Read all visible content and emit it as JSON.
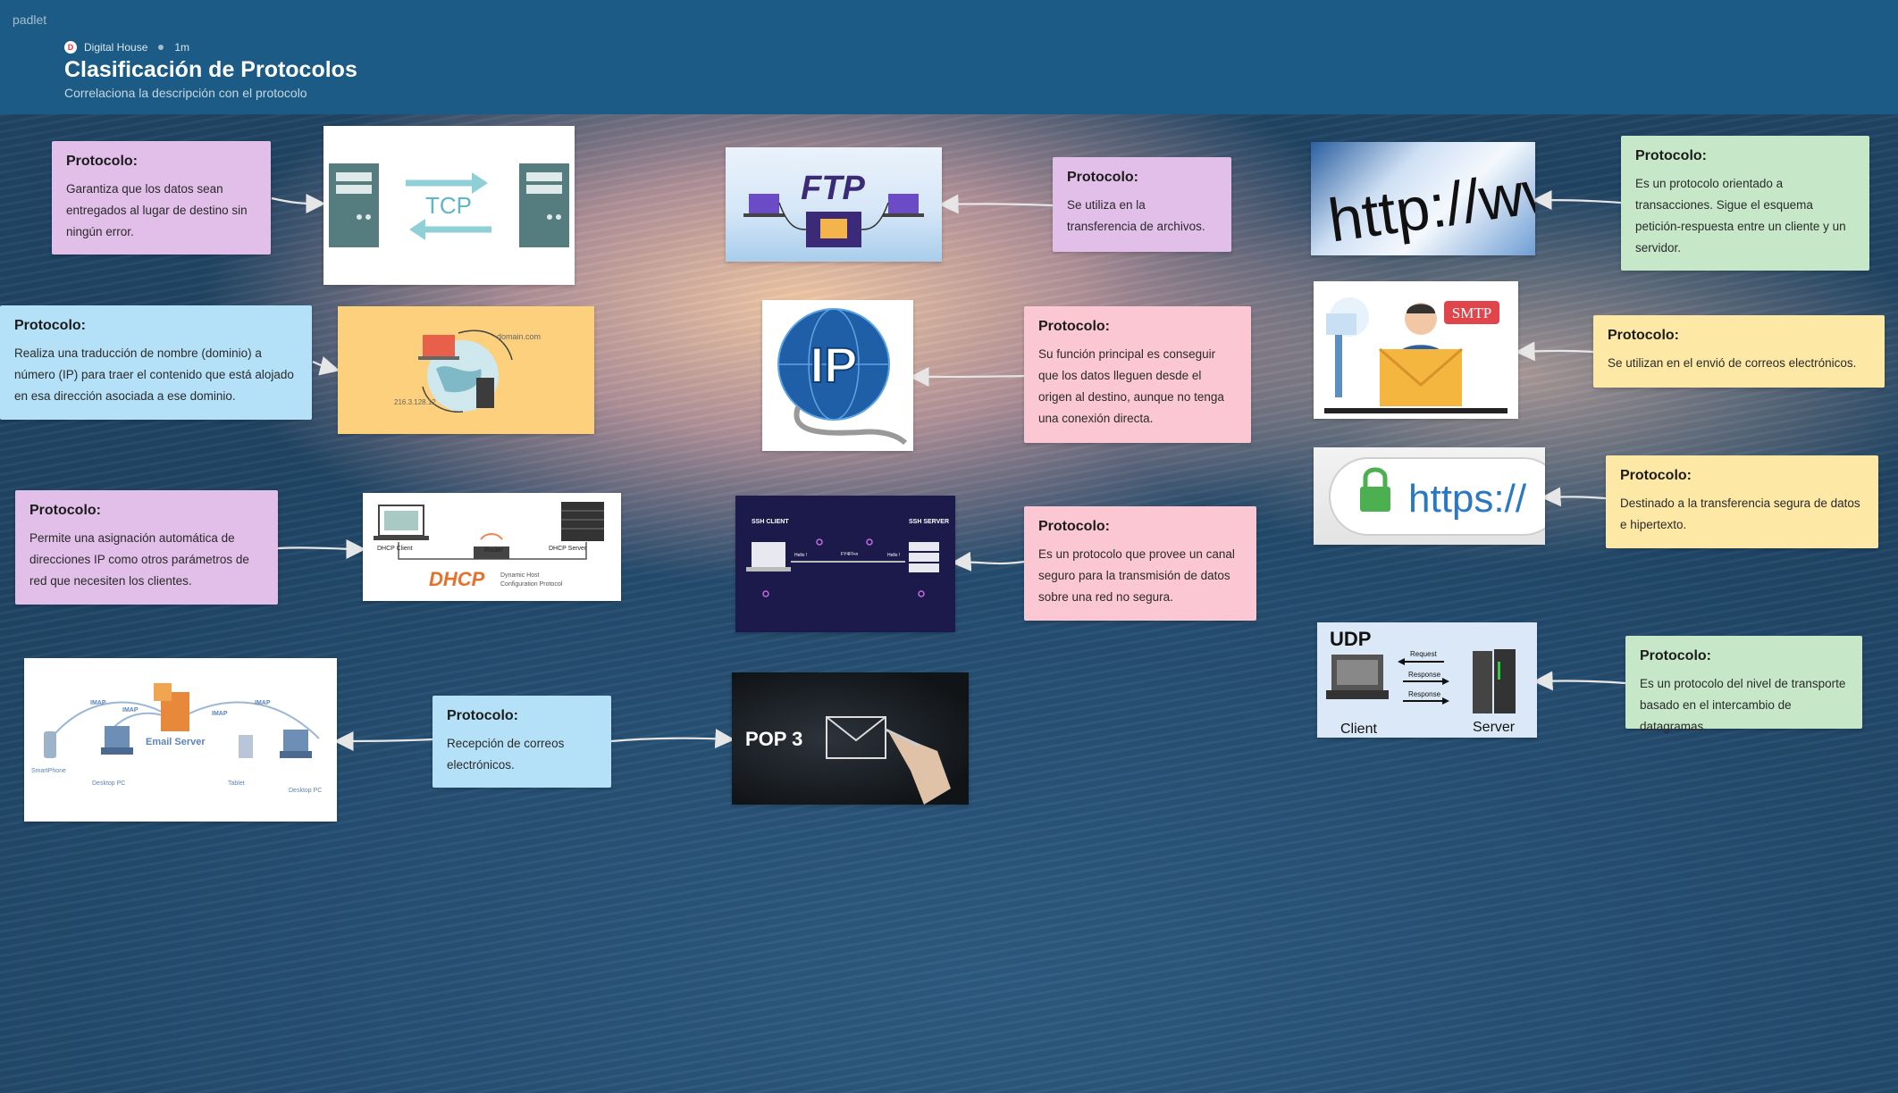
{
  "header": {
    "brand": "padlet",
    "author": "Digital House",
    "age": "1m",
    "title": "Clasificación de Protocolos",
    "subtitle": "Correlaciona la descripción con el protocolo"
  },
  "cards": [
    {
      "id": "tcp",
      "title": "Protocolo:",
      "text": "Garantiza que los datos sean entregados al lugar de destino sin ningún error."
    },
    {
      "id": "dns",
      "title": "Protocolo:",
      "text": "Realiza una traducción de nombre (dominio) a número (IP) para traer el contenido que está alojado en esa dirección asociada a ese dominio."
    },
    {
      "id": "dhcp",
      "title": "Protocolo:",
      "text": "Permite una asignación automática de direcciones IP como otros parámetros de red que necesiten los clientes."
    },
    {
      "id": "imap",
      "title": "Protocolo:",
      "text": "Recepción de correos electrónicos."
    },
    {
      "id": "ftp",
      "title": "Protocolo:",
      "text": "Se utiliza en la transferencia de archivos."
    },
    {
      "id": "ip",
      "title": "Protocolo:",
      "text": "Su función principal es conseguir que los datos lleguen desde el origen al destino, aunque no tenga una conexión directa."
    },
    {
      "id": "ssh",
      "title": "Protocolo:",
      "text": "Es un protocolo que provee un canal seguro para la transmisión de datos sobre una red no segura."
    },
    {
      "id": "http",
      "title": "Protocolo:",
      "text": "Es un protocolo orientado a transacciones. Sigue el esquema petición-respuesta entre un cliente y un servidor."
    },
    {
      "id": "smtp",
      "title": "Protocolo:",
      "text": "Se utilizan en el envió de correos electrónicos."
    },
    {
      "id": "https",
      "title": "Protocolo:",
      "text": "Destinado a la transferencia segura de datos e hipertexto."
    },
    {
      "id": "udp",
      "title": "Protocolo:",
      "text": "Es un protocolo del nivel de transporte basado en el intercambio de datagramas."
    }
  ],
  "images": {
    "tcp": {
      "label": "TCP"
    },
    "ftp": {
      "label": "FTP"
    },
    "http": {
      "label": "http://www"
    },
    "dns": {
      "domain": "domain.com",
      "ip": "216.3.128.12"
    },
    "ip": {
      "label": "IP"
    },
    "smtp": {
      "label": "SMTP"
    },
    "https": {
      "label": "https://"
    },
    "dhcp": {
      "label": "DHCP",
      "client": "DHCP Client",
      "router": "Router",
      "server": "DHCP Server",
      "desc1": "Dynamic Host",
      "desc2": "Configuration Protocol"
    },
    "ssh": {
      "client": "SSH CLIENT",
      "server": "SSH SERVER",
      "hello1": "Hello !",
      "hello2": "Hello !",
      "mid": "FY4Ff+n"
    },
    "udp": {
      "label": "UDP",
      "request": "Request",
      "response1": "Response",
      "response2": "Response",
      "client": "Client",
      "server": "Server"
    },
    "imap": {
      "server": "Email Server",
      "smartphone": "SmartPhone",
      "desktop1": "Desktop PC",
      "tablet": "Tablet",
      "desktop2": "Desktop PC",
      "imap": "IMAP"
    },
    "pop3": {
      "label": "POP 3"
    }
  }
}
